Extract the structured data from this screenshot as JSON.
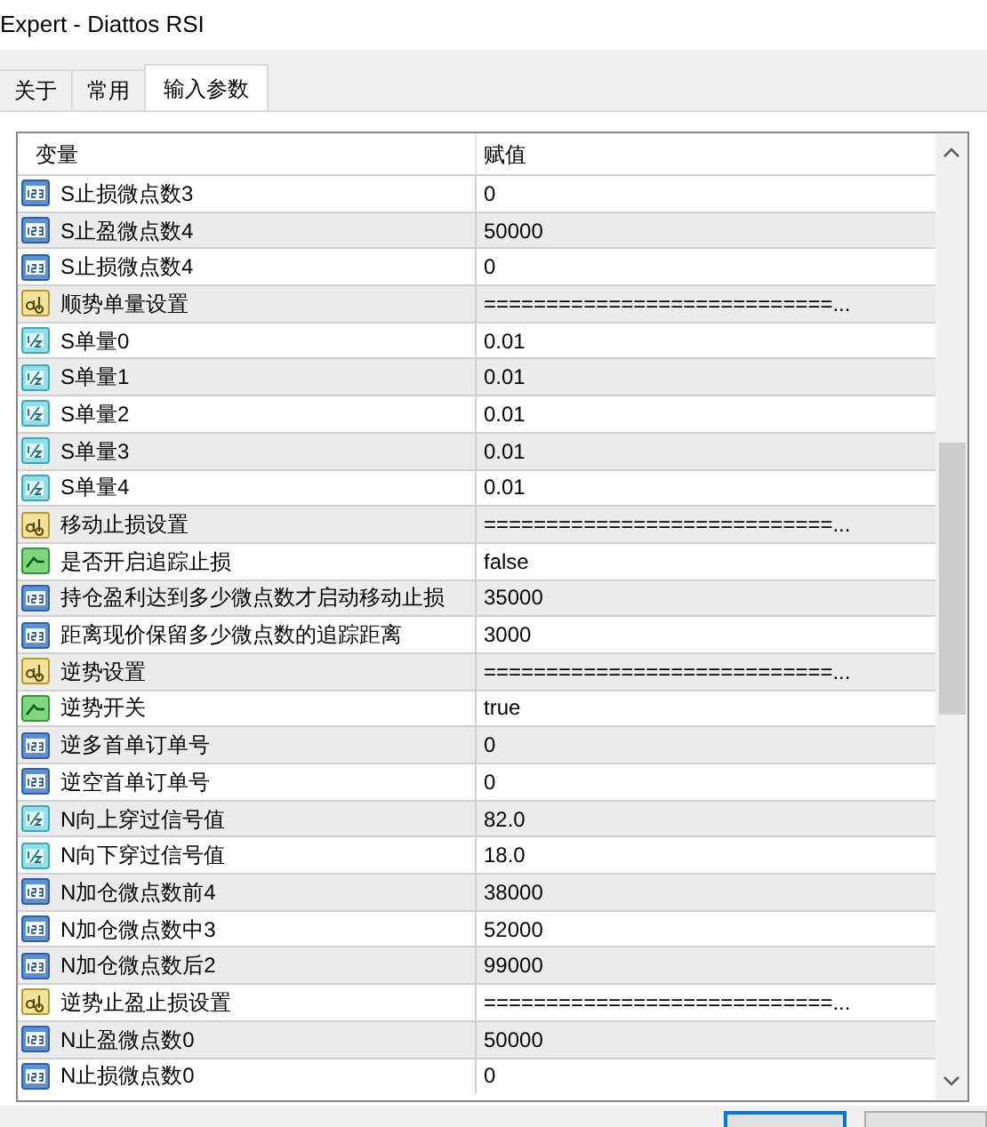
{
  "window": {
    "title": "Expert - Diattos RSI"
  },
  "tabs": [
    {
      "label": "关于",
      "selected": false
    },
    {
      "label": "常用",
      "selected": false
    },
    {
      "label": "输入参数",
      "selected": true
    }
  ],
  "table": {
    "columns": [
      "变量",
      "赋值"
    ],
    "rows": [
      {
        "kind": "int",
        "name": "S止损微点数3",
        "value": "0"
      },
      {
        "kind": "int",
        "name": "S止盈微点数4",
        "value": "50000"
      },
      {
        "kind": "int",
        "name": "S止损微点数4",
        "value": "0"
      },
      {
        "kind": "string",
        "name": "顺势单量设置",
        "value": "============================..."
      },
      {
        "kind": "double",
        "name": "S单量0",
        "value": "0.01"
      },
      {
        "kind": "double",
        "name": "S单量1",
        "value": "0.01"
      },
      {
        "kind": "double",
        "name": "S单量2",
        "value": "0.01"
      },
      {
        "kind": "double",
        "name": "S单量3",
        "value": "0.01"
      },
      {
        "kind": "double",
        "name": "S单量4",
        "value": "0.01"
      },
      {
        "kind": "string",
        "name": "移动止损设置",
        "value": "============================..."
      },
      {
        "kind": "bool",
        "name": "是否开启追踪止损",
        "value": "false"
      },
      {
        "kind": "int",
        "name": "持仓盈利达到多少微点数才启动移动止损",
        "value": "35000"
      },
      {
        "kind": "int",
        "name": "距离现价保留多少微点数的追踪距离",
        "value": "3000"
      },
      {
        "kind": "string",
        "name": "逆势设置",
        "value": "============================..."
      },
      {
        "kind": "bool",
        "name": "逆势开关",
        "value": "true"
      },
      {
        "kind": "int",
        "name": "逆多首单订单号",
        "value": "0"
      },
      {
        "kind": "int",
        "name": "逆空首单订单号",
        "value": "0"
      },
      {
        "kind": "double",
        "name": "N向上穿过信号值",
        "value": "82.0"
      },
      {
        "kind": "double",
        "name": "N向下穿过信号值",
        "value": "18.0"
      },
      {
        "kind": "int",
        "name": "N加仓微点数前4",
        "value": "38000"
      },
      {
        "kind": "int",
        "name": "N加仓微点数中3",
        "value": "52000"
      },
      {
        "kind": "int",
        "name": "N加仓微点数后2",
        "value": "99000"
      },
      {
        "kind": "string",
        "name": "逆势止盈止损设置",
        "value": "============================..."
      },
      {
        "kind": "int",
        "name": "N止盈微点数0",
        "value": "50000"
      },
      {
        "kind": "int",
        "name": "N止损微点数0",
        "value": "0"
      }
    ]
  },
  "buttons": [
    {
      "default": true
    },
    {
      "default": false
    }
  ]
}
